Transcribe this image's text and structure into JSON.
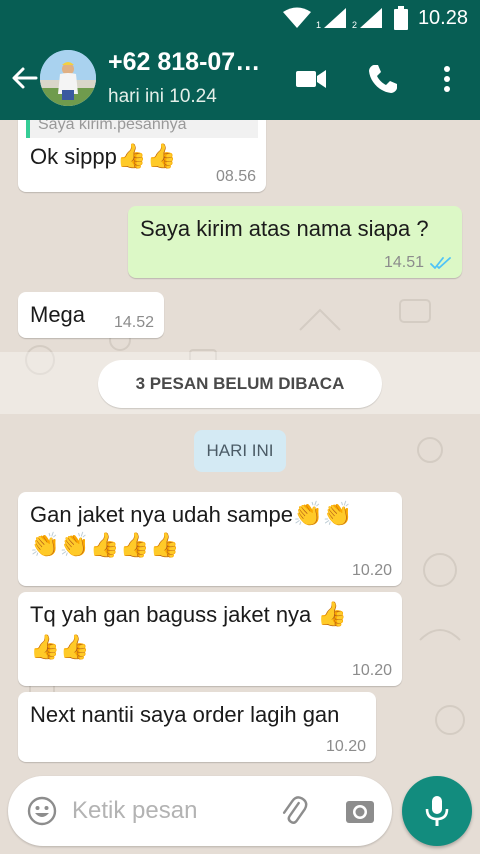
{
  "status_bar": {
    "time": "10.28",
    "sim1": "1",
    "sim2": "2"
  },
  "header": {
    "contact_name": "+62 818-07…",
    "last_seen": "hari ini 10.24",
    "icons": [
      "back-arrow-icon",
      "video-call-icon",
      "phone-icon",
      "more-vert-icon"
    ]
  },
  "messages": [
    {
      "direction": "in",
      "quoted": "Saya kirim.pesannya",
      "text": "Ok sippp",
      "emoji": "👍👍",
      "time": "08.56"
    },
    {
      "direction": "out",
      "text": "Saya kirim atas nama siapa ?",
      "time": "14.51",
      "status": "read"
    },
    {
      "direction": "in",
      "text": "Mega",
      "time": "14.52"
    },
    {
      "direction": "in",
      "text": "Gan jaket nya udah sampe",
      "emoji_line1": "👏👏",
      "emoji_line2": "👏👏👍👍👍",
      "time": "10.20"
    },
    {
      "direction": "in",
      "text": "Tq yah gan baguss jaket nya",
      "emoji_line1": "👍",
      "emoji_line2": "👍👍",
      "time": "10.20"
    },
    {
      "direction": "in",
      "text": "Next nantii saya order lagih gan",
      "time": "10.20"
    }
  ],
  "unread_banner": "3 PESAN BELUM DIBACA",
  "date_divider": "HARI INI",
  "composer": {
    "placeholder": "Ketik pesan",
    "icons": [
      "emoji-icon",
      "attach-icon",
      "camera-icon",
      "mic-icon"
    ]
  },
  "colors": {
    "header": "#075e54",
    "incoming_bubble": "#ffffff",
    "outgoing_bubble": "#dcf8c6",
    "chat_bg": "#e5ddd5",
    "read_tick": "#4fc3f7",
    "mic_button": "#128c7e"
  }
}
